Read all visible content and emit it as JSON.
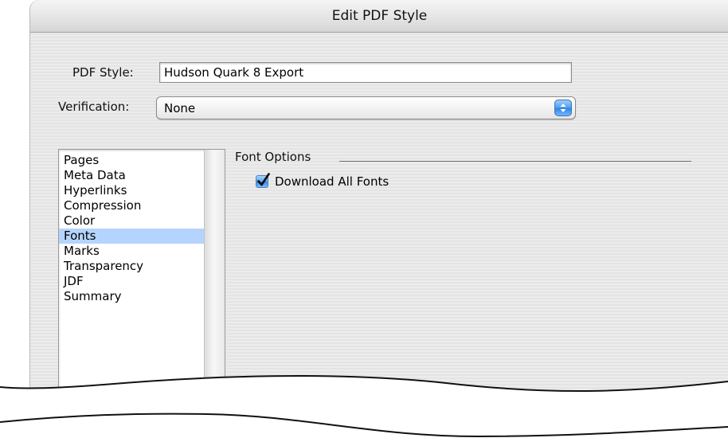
{
  "window": {
    "title": "Edit PDF Style"
  },
  "form": {
    "pdf_style_label": "PDF Style:",
    "pdf_style_value": "Hudson Quark 8 Export",
    "verification_label": "Verification:",
    "verification_value": "None"
  },
  "sidebar": {
    "items": [
      {
        "label": "Pages"
      },
      {
        "label": "Meta Data"
      },
      {
        "label": "Hyperlinks"
      },
      {
        "label": "Compression"
      },
      {
        "label": "Color"
      },
      {
        "label": "Fonts",
        "selected": true
      },
      {
        "label": "Marks"
      },
      {
        "label": "Transparency"
      },
      {
        "label": "JDF"
      },
      {
        "label": "Summary"
      }
    ],
    "selected_index": 5
  },
  "panel": {
    "section_title": "Font Options",
    "download_all_fonts": {
      "label": "Download All Fonts",
      "checked": true
    }
  },
  "icons": {
    "popup_arrows": "up-down-arrows-icon",
    "checkmark": "checkmark-icon"
  },
  "colors": {
    "selection": "#b5d4fd",
    "aqua_blue": "#4f9ff0",
    "window_bg": "#ececec"
  }
}
